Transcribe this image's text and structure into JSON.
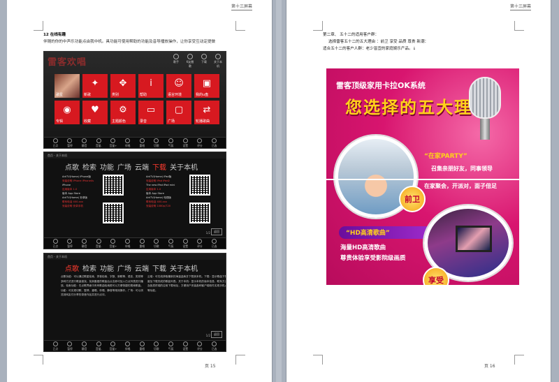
{
  "left_page": {
    "header": "第十三屏幕",
    "section_title": "12 在线有趣",
    "intro": "伴随的你的中声乐功能点由我中机。具功能可使用帮助的功能及音导播放操作，让你享受互动定提做",
    "footer": "页 15",
    "home": {
      "logo": "雷客欢唱",
      "top_icons": [
        "歌手",
        "K友圈歌",
        "下载",
        "关于本机"
      ],
      "tiles": [
        {
          "label": "歌星",
          "glyph": ""
        },
        {
          "label": "新歌",
          "glyph": "✦"
        },
        {
          "label": "类别",
          "glyph": "✥"
        },
        {
          "label": "帮助",
          "glyph": "i"
        },
        {
          "label": "语言环境",
          "glyph": "☺"
        },
        {
          "label": "我的u盘",
          "glyph": "▣"
        },
        {
          "label": "专辑",
          "glyph": "◉"
        },
        {
          "label": "收藏",
          "glyph": "♥"
        },
        {
          "label": "主题颜色",
          "glyph": "⚙"
        },
        {
          "label": "录音",
          "glyph": "▭"
        },
        {
          "label": "广场",
          "glyph": "▢"
        },
        {
          "label": "轮播歌曲",
          "glyph": "⇄"
        }
      ]
    },
    "bottom_bar": [
      "已点",
      "暂停",
      "静音",
      "音量-",
      "音量+",
      "伴唱",
      "重唱",
      "切歌",
      "气氛",
      "设置",
      "评分",
      "已选"
    ],
    "about": {
      "titlebar": "首页 - 关于本机",
      "tabs": [
        "点歌",
        "检索",
        "功能",
        "广场",
        "云端",
        "下载",
        "关于本机"
      ],
      "active_tab": "下载",
      "col1": [
        "ArkTV(Home) iPhone版",
        "安装说明 iPhone iPhone4s",
        "iPhone",
        "应用版本 1.0",
        "版本 App Store",
        "ArkTV(Home) 安卓版",
        "联系电话 400-xxx",
        "安装说明 安卓手机"
      ],
      "col2": [
        "ArkTV(Home) iPad版",
        "安装说明 iPad iPad2",
        "The new iPad iPad mini",
        "应用版本 1.0",
        "版本 App Store",
        "ArkTV(Home) 电视版",
        "联系电话 400-xxx",
        "安装说明 1080p/720"
      ],
      "page": "1/2",
      "back": "返回"
    },
    "about2": {
      "titlebar": "首页 - 关于本机",
      "tabs": [
        "点歌",
        "检索",
        "功能",
        "广场",
        "云端",
        "下载",
        "关于本机"
      ],
      "active_tab": "点歌",
      "para1": "点歌功能：可以通过歌星检索、拼音检索、字数、新歌等、语言、类别等多种方式进行歌曲查找，找到喜爱的歌曲后点击即可加入已点列表进行播放。检索功能：在点歌界面中央有歌曲检索框可以方便快捷的搜索歌曲。功能：可实现切歌、暂停、重唱、伴唱、静音等常用操作。广场：可以浏览到网友们分享的录音作品并进行点评。",
      "para2": "云端：可在线获取最新的海量曲库并下载到本机。下载：显示歌曲下载进度及下载完成的歌曲列表。关于本机：显示本机的版本信息、联系方式以及各类终端的应用下载地址，方便用户安装各种客户端软件实现手机点歌等功能。",
      "page": "1/2",
      "back": "返回"
    }
  },
  "right_page": {
    "header": "第十三屏幕",
    "line1": "第二章、 五十二的适用客户群：",
    "line2": "选择雷客五十二的五大理由 ：前卫 享受 品质 尊贵 新潮：",
    "line3": "适合五十二的客户人群：老少皆宜的家庭娱乐产品。↓",
    "footer": "页 16",
    "promo": {
      "title": "雷客顶级家用卡拉OK系统",
      "headline": "您选择的五大理由",
      "reason1_title": "“在家PARTY”",
      "reason1_line1": "召集亲朋好友，同事领导",
      "reason1_line2": "在家聚会，开派对，面子倍足",
      "reason1_badge": "前卫",
      "reason2_title": "“HD高清歌曲”",
      "reason2_line1": "海量HD高清歌曲",
      "reason2_line2": "尊贵体验享受影院级画质",
      "reason2_badge": "享受"
    }
  }
}
